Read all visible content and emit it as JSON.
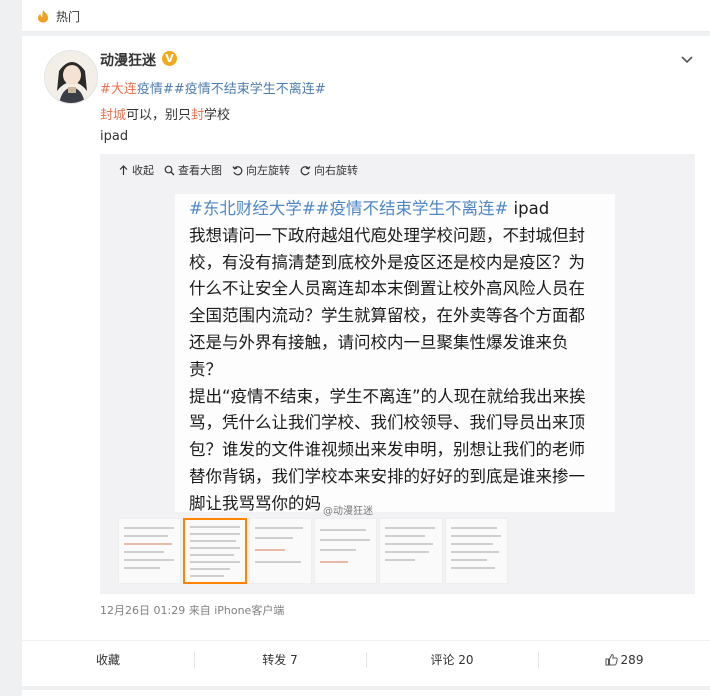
{
  "header": {
    "hot_label": "热门",
    "flame_icon": "flame-icon"
  },
  "post": {
    "username": "动漫狂迷",
    "verified_badge": "V",
    "tags": {
      "t1_red": "#大连",
      "t1_blue": "疫情##疫情不结束学生不离连#"
    },
    "text_line2": {
      "a_red": "封城",
      "b": "可以，别只",
      "c_red": "封",
      "d": "学校"
    },
    "text_line3": "ipad",
    "media_toolbar": {
      "collapse": "收起",
      "view_large": "查看大图",
      "rotate_left": "向左旋转",
      "rotate_right": "向右旋转"
    },
    "image_text": {
      "hashtag": "#东北财经大学##疫情不结束学生不离连#",
      "hashtag_suffix": " ipad",
      "body1": "我想请问一下政府越俎代庖处理学校问题，不封城但封校，有没有搞清楚到底校外是疫区还是校内是疫区？为什么不让安全人员离连却本末倒置让校外高风险人员在全国范围内流动？学生就算留校，在外卖等各个方面都还是与外界有接触，请问校内一旦聚集性爆发谁来负责？",
      "body2": "提出“疫情不结束，学生不离连”的人现在就给我出来挨骂，凭什么让我们学校、我们校领导、我们导员出来顶包？谁发的文件谁视频出来发申明，别想让我们的老师替你背锅，我们学校本来安排的好好的到底是谁来掺一脚让我骂骂你的妈",
      "watermark": "@动漫狂迷"
    },
    "timestamp": "12月26日 01:29",
    "source": "来自 iPhone客户端",
    "actions": {
      "favorite": "收藏",
      "repost": "转发 7",
      "comment": "评论 20",
      "like": "289"
    }
  }
}
